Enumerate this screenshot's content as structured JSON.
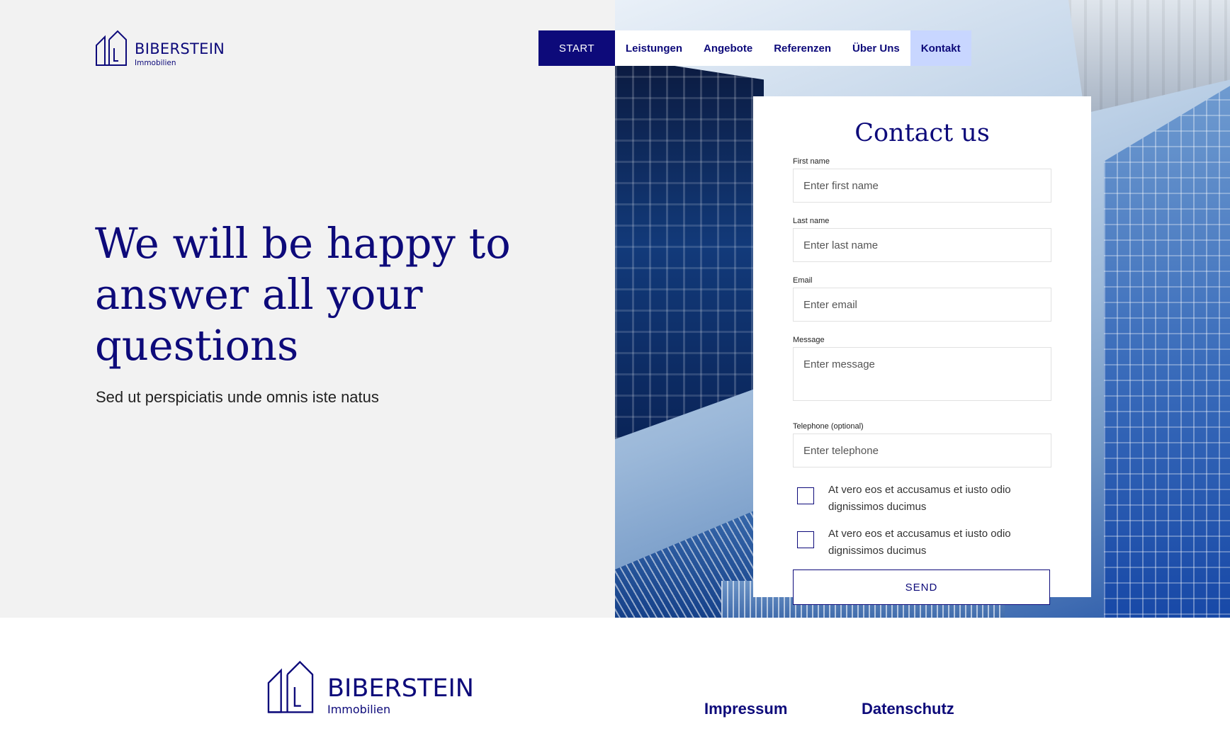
{
  "brand": {
    "name": "BIBERSTEIN",
    "sub": "Immobilien"
  },
  "nav": {
    "start": "START",
    "items": [
      "Leistungen",
      "Angebote",
      "Referenzen",
      "Über Uns",
      "Kontakt"
    ]
  },
  "hero": {
    "headline": "We will be happy to answer all your questions",
    "subline": "Sed ut perspiciatis unde omnis iste natus"
  },
  "form": {
    "title": "Contact us",
    "first_name": {
      "label": "First name",
      "placeholder": "Enter first name"
    },
    "last_name": {
      "label": "Last name",
      "placeholder": "Enter last name"
    },
    "email": {
      "label": "Email",
      "placeholder": "Enter email"
    },
    "message": {
      "label": "Message",
      "placeholder": "Enter message"
    },
    "telephone": {
      "label": "Telephone (optional)",
      "placeholder": "Enter telephone"
    },
    "consent_1": "At vero eos et accusamus et iusto odio dignissimos ducimus",
    "consent_2": "At vero eos et accusamus et iusto odio dignissimos ducimus",
    "send": "SEND"
  },
  "footer": {
    "impressum": "Impressum",
    "datenschutz": "Datenschutz"
  },
  "colors": {
    "navy": "#0d0a7a",
    "active_tab": "#c8d6ff",
    "hero_bg": "#f2f2f2"
  },
  "icons": {
    "logo": "house-outline-icon"
  }
}
